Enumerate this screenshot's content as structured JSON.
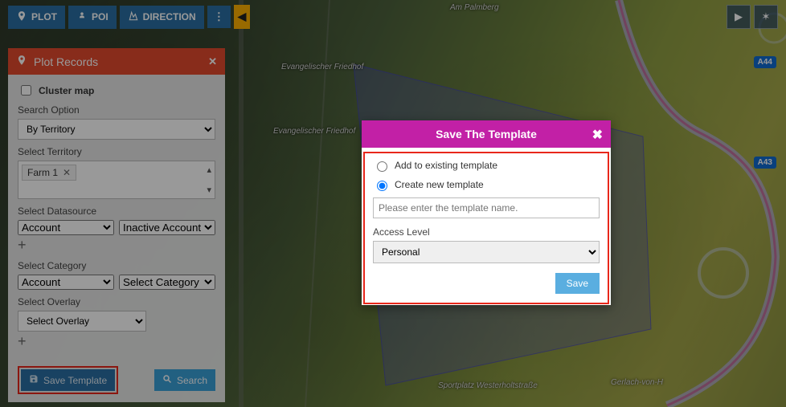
{
  "toolbar": {
    "plot": "PLOT",
    "poi": "POI",
    "direction": "DIRECTION",
    "plot_icon": "pin-icon",
    "poi_icon": "pin-person-icon",
    "direction_icon": "route-icon"
  },
  "badges": {
    "a44": "A44",
    "a43": "A43"
  },
  "map_labels": {
    "am_palmberg": "Am Palmberg",
    "friedhof": "Evangelischer Friedhof",
    "friedhof2": "Evangelischer Friedhof",
    "sportplatz": "Sportplatz Westerholtstraße",
    "gerlach": "Gerlach-von-H"
  },
  "panel": {
    "icon": "pin-icon",
    "title": "Plot Records",
    "cluster_label": "Cluster map",
    "search_option_label": "Search Option",
    "search_option_value": "By Territory",
    "select_territory_label": "Select Territory",
    "territory_tag": "Farm 1",
    "select_datasource_label": "Select Datasource",
    "datasource_a": "Account",
    "datasource_b": "Inactive Account",
    "select_category_label": "Select Category",
    "category_a": "Account",
    "category_b": "Select Category",
    "select_overlay_label": "Select Overlay",
    "overlay_value": "Select Overlay",
    "save_template_label": "Save Template",
    "search_label": "Search",
    "save_icon": "save-icon",
    "search_icon": "search-icon"
  },
  "modal": {
    "title": "Save The Template",
    "radio_existing": "Add to existing template",
    "radio_new": "Create new template",
    "selected": "new",
    "name_placeholder": "Please enter the template name.",
    "name_value": "",
    "access_label": "Access Level",
    "access_value": "Personal",
    "save_label": "Save"
  }
}
